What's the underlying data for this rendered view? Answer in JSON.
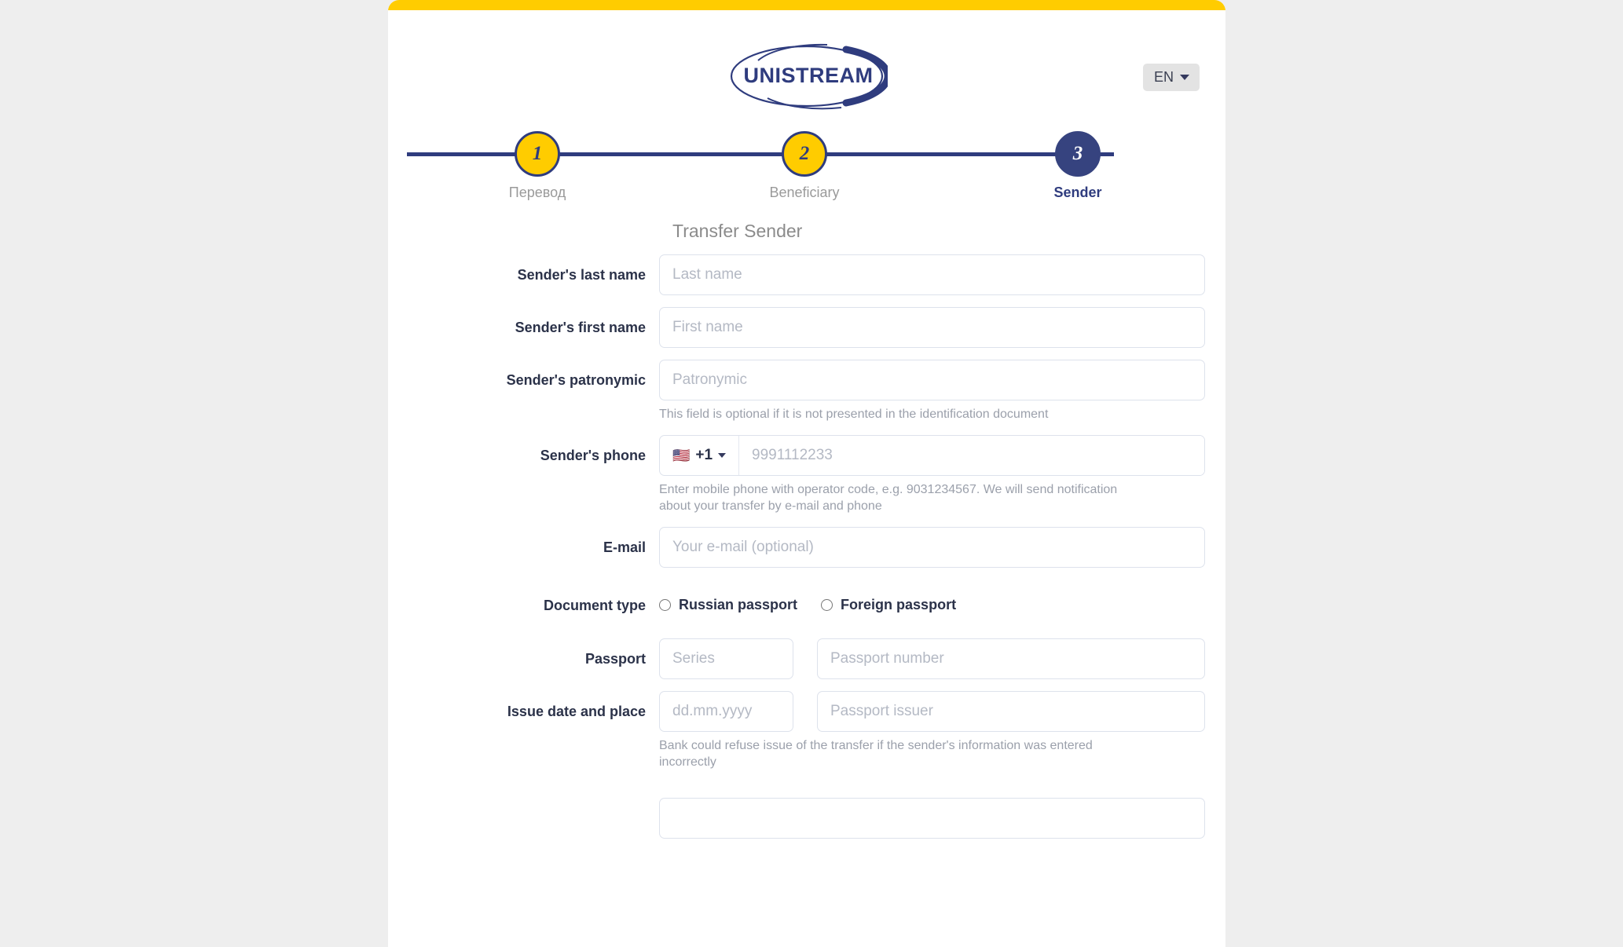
{
  "brand": {
    "logo_text": "UNISTREAM",
    "accent_yellow": "#FFCC00",
    "accent_navy": "#2F3C7E"
  },
  "header": {
    "language_label": "EN",
    "language_caret_icon": "chevron-down-icon"
  },
  "stepper": {
    "steps": [
      {
        "number": "1",
        "label": "Перевод",
        "state": "todo"
      },
      {
        "number": "2",
        "label": "Beneficiary",
        "state": "todo"
      },
      {
        "number": "3",
        "label": "Sender",
        "state": "active"
      }
    ]
  },
  "form": {
    "section_title": "Transfer Sender",
    "last_name": {
      "label": "Sender's last name",
      "placeholder": "Last name",
      "value": ""
    },
    "first_name": {
      "label": "Sender's first name",
      "placeholder": "First name",
      "value": ""
    },
    "patronymic": {
      "label": "Sender's patronymic",
      "placeholder": "Patronymic",
      "value": "",
      "hint": "This field is optional if it is not presented in the identification document"
    },
    "phone": {
      "label": "Sender's phone",
      "country_flag": "🇺🇸",
      "country_code": "+1",
      "placeholder": "9991112233",
      "value": "",
      "hint": "Enter mobile phone with operator code, e.g. 9031234567. We will send notification about your transfer by e-mail and phone"
    },
    "email": {
      "label": "E-mail",
      "placeholder": "Your e-mail (optional)",
      "value": ""
    },
    "document_type": {
      "label": "Document type",
      "options": [
        {
          "label": "Russian passport",
          "checked": false
        },
        {
          "label": "Foreign passport",
          "checked": false
        }
      ]
    },
    "passport": {
      "label": "Passport",
      "series_placeholder": "Series",
      "series_value": "",
      "number_placeholder": "Passport number",
      "number_value": ""
    },
    "issue": {
      "label": "Issue date and place",
      "date_placeholder": "dd.mm.yyyy",
      "date_value": "",
      "issuer_placeholder": "Passport issuer",
      "issuer_value": "",
      "hint": "Bank could refuse issue of the transfer if the sender's information was entered incorrectly"
    }
  }
}
